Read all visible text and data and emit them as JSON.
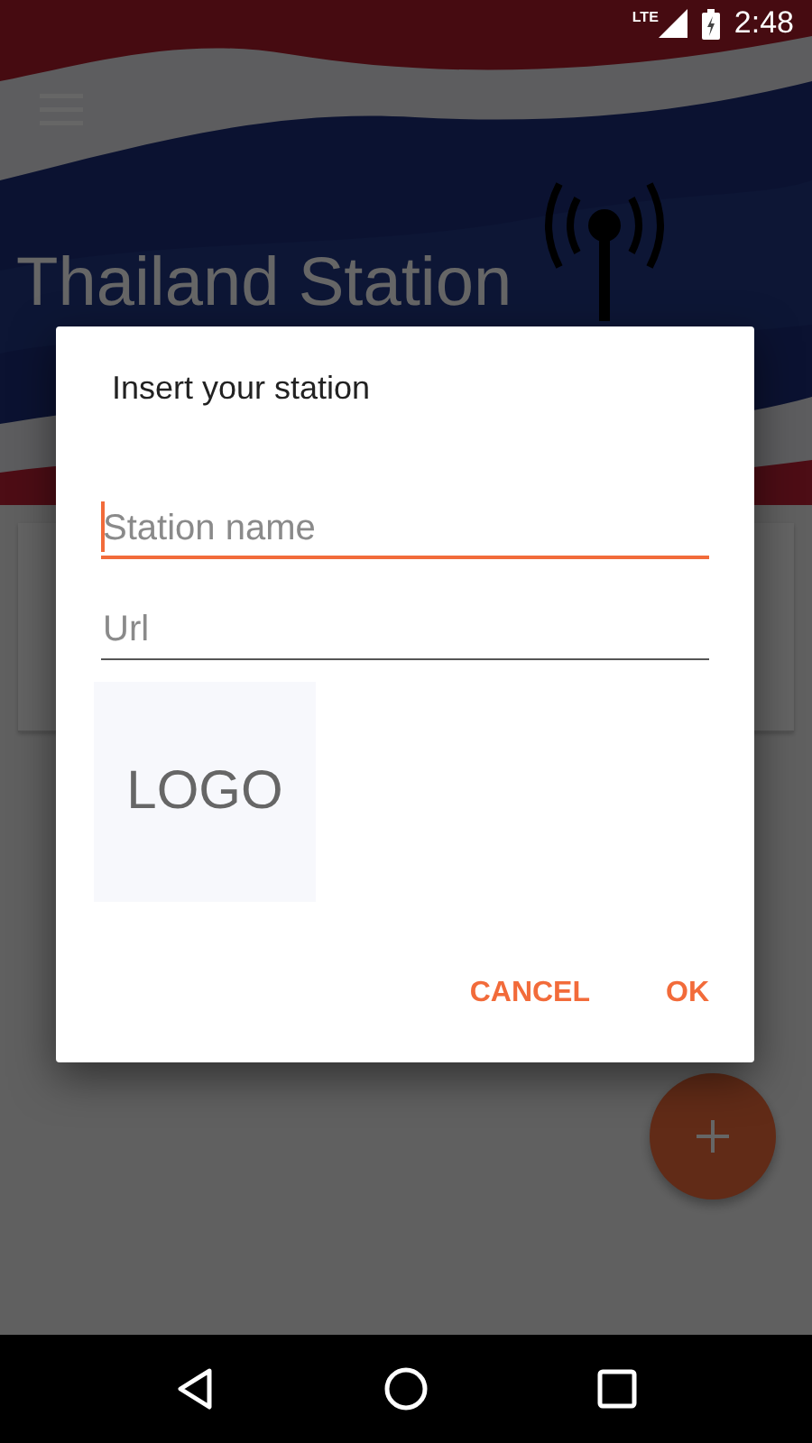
{
  "status_bar": {
    "network": "LTE",
    "time": "2:48"
  },
  "header": {
    "title": "Thailand Station"
  },
  "dialog": {
    "title": "Insert your station",
    "fields": [
      {
        "placeholder": "Station name",
        "focused": true
      },
      {
        "placeholder": "Url",
        "focused": false
      }
    ],
    "logo": {
      "label": "LOGO"
    },
    "buttons": [
      "CANCEL",
      "OK"
    ]
  }
}
